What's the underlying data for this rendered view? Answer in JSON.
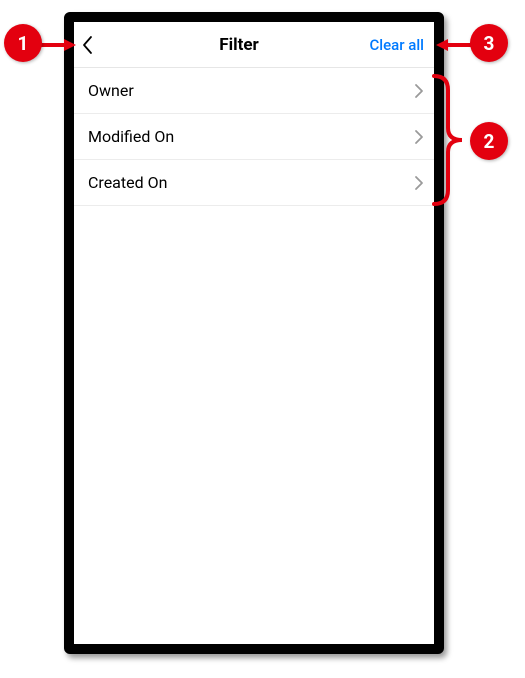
{
  "header": {
    "title": "Filter",
    "clear_all": "Clear all"
  },
  "filters": [
    {
      "label": "Owner"
    },
    {
      "label": "Modified On"
    },
    {
      "label": "Created On"
    }
  ],
  "annotations": {
    "a1": "1",
    "a2": "2",
    "a3": "3"
  },
  "colors": {
    "accent": "#007aff",
    "annotation": "#e3000f"
  }
}
